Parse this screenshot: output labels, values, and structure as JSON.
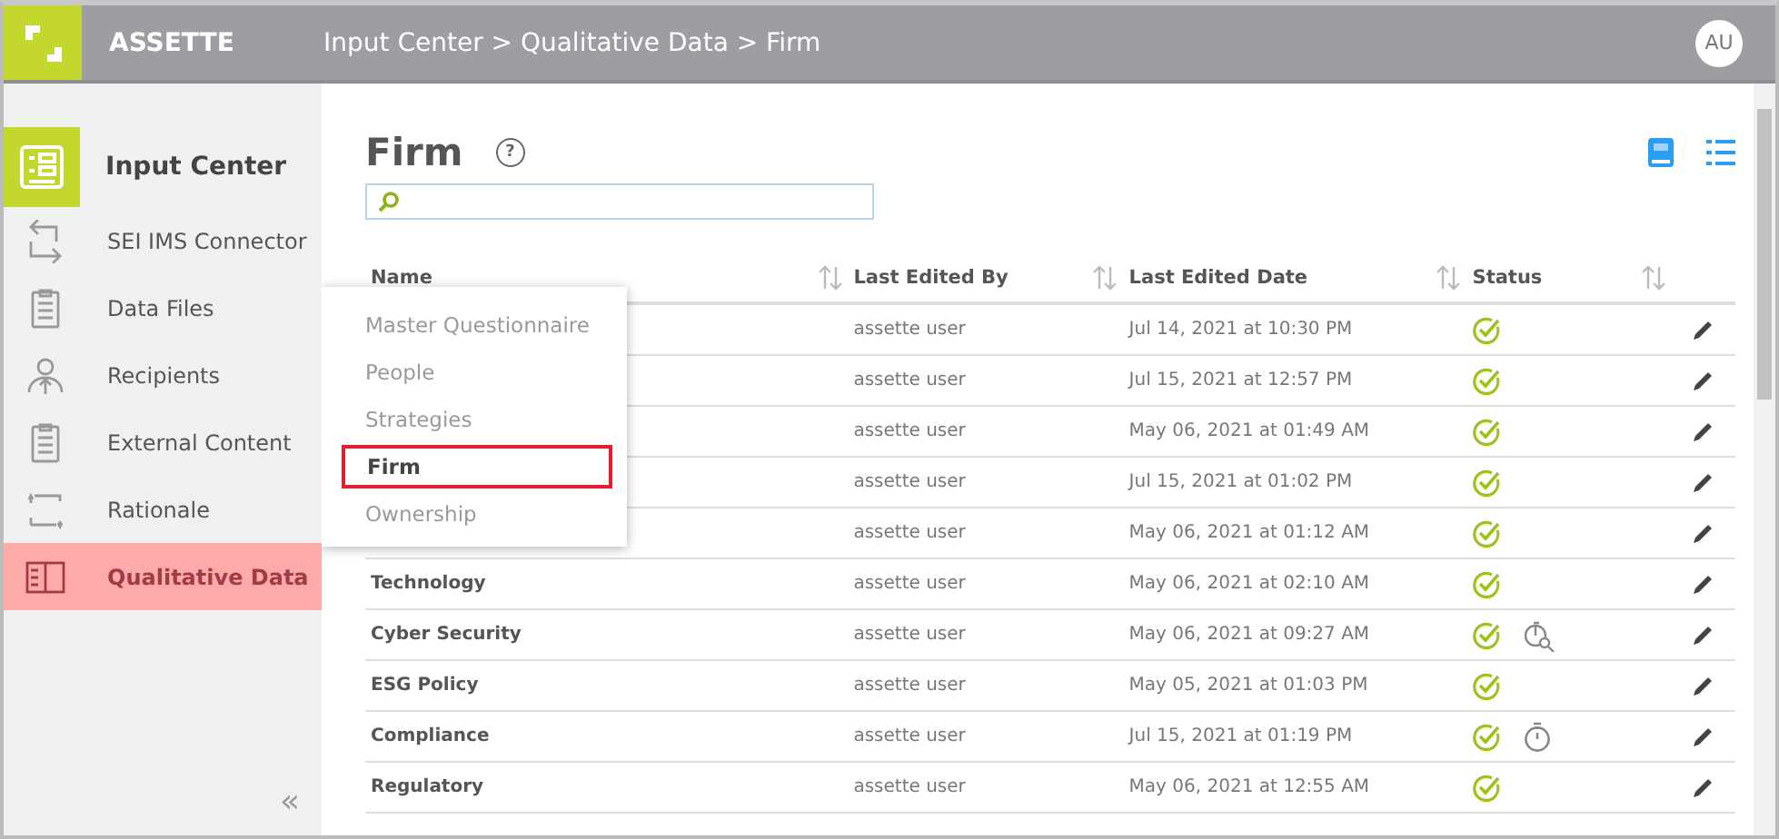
{
  "header": {
    "app_name": "ASSETTE",
    "breadcrumb": "Input Center > Qualitative Data > Firm",
    "avatar": "AU"
  },
  "sidebar": {
    "title": "Input Center",
    "items": [
      {
        "label": "SEI IMS Connector",
        "kind": "connector",
        "selected": false
      },
      {
        "label": "Data Files",
        "kind": "clipboard",
        "selected": false
      },
      {
        "label": "Recipients",
        "kind": "person",
        "selected": false
      },
      {
        "label": "External Content",
        "kind": "clipboard",
        "selected": false
      },
      {
        "label": "Rationale",
        "kind": "arrows",
        "selected": false
      },
      {
        "label": "Qualitative Data",
        "kind": "book",
        "selected": true
      }
    ],
    "collapse": "«"
  },
  "page": {
    "title": "Firm",
    "help": "?"
  },
  "dropdown": {
    "items": [
      {
        "label": "Master Questionnaire",
        "selected": false
      },
      {
        "label": "People",
        "selected": false
      },
      {
        "label": "Strategies",
        "selected": false
      },
      {
        "label": "Firm",
        "selected": true
      },
      {
        "label": "Ownership",
        "selected": false
      }
    ]
  },
  "table": {
    "columns": [
      "Name",
      "Last Edited By",
      "Last Edited Date",
      "Status"
    ],
    "rows": [
      {
        "edited_by": "assette user",
        "date": "Jul 14, 2021 at 10:30 PM",
        "kind": "done"
      },
      {
        "edited_by": "assette user",
        "date": "Jul 15, 2021 at 12:57 PM",
        "kind": "done"
      },
      {
        "edited_by": "assette user",
        "date": "May 06, 2021 at 01:49 AM",
        "kind": "done"
      },
      {
        "edited_by": "assette user",
        "date": "Jul 15, 2021 at 01:02 PM",
        "kind": "done"
      },
      {
        "edited_by": "assette user",
        "date": "May 06, 2021 at 01:12 AM",
        "kind": "done"
      },
      {
        "name": "Technology",
        "edited_by": "assette user",
        "date": "May 06, 2021 at 02:10 AM",
        "kind": "done"
      },
      {
        "name": "Cyber Security",
        "edited_by": "assette user",
        "date": "May 06, 2021 at 09:27 AM",
        "kind": "review"
      },
      {
        "name": "ESG Policy",
        "edited_by": "assette user",
        "date": "May 05, 2021 at 01:03 PM",
        "kind": "done"
      },
      {
        "name": "Compliance",
        "edited_by": "assette user",
        "date": "Jul 15, 2021 at 01:19 PM",
        "kind": "timer"
      },
      {
        "name": "Regulatory",
        "edited_by": "assette user",
        "date": "May 06, 2021 at 12:55 AM",
        "kind": "done"
      }
    ]
  }
}
